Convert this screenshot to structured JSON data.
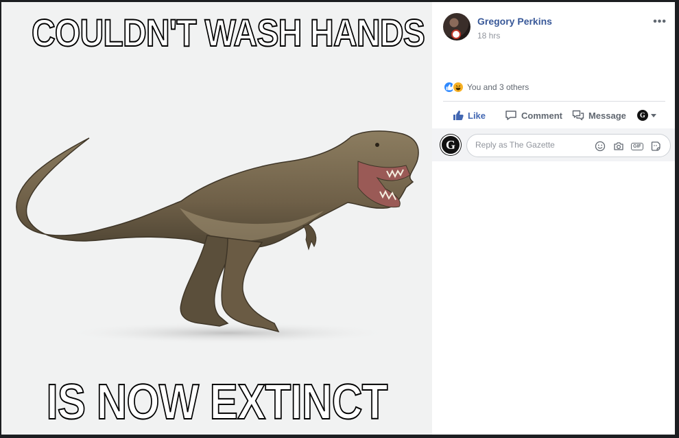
{
  "meme": {
    "caption_top": "COULDN'T WASH HANDS",
    "caption_bottom": "IS NOW EXTINCT",
    "subject": "tyrannosaurus"
  },
  "post": {
    "author": "Gregory Perkins",
    "time": "18 hrs",
    "more_icon": "•••"
  },
  "reactions": {
    "text": "You and 3 others",
    "icons": [
      "like-icon",
      "haha-icon"
    ],
    "like_color": "#2e89ff",
    "haha_color": "#f7b125"
  },
  "actions": {
    "like": "Like",
    "comment": "Comment",
    "message": "Message",
    "page_logo_letter": "G"
  },
  "comment_box": {
    "placeholder": "Reply as The Gazette",
    "page_logo_letter": "G",
    "gif_label": "GIF"
  },
  "colors": {
    "link": "#385898",
    "like_active": "#4267b2",
    "muted": "#606770"
  }
}
